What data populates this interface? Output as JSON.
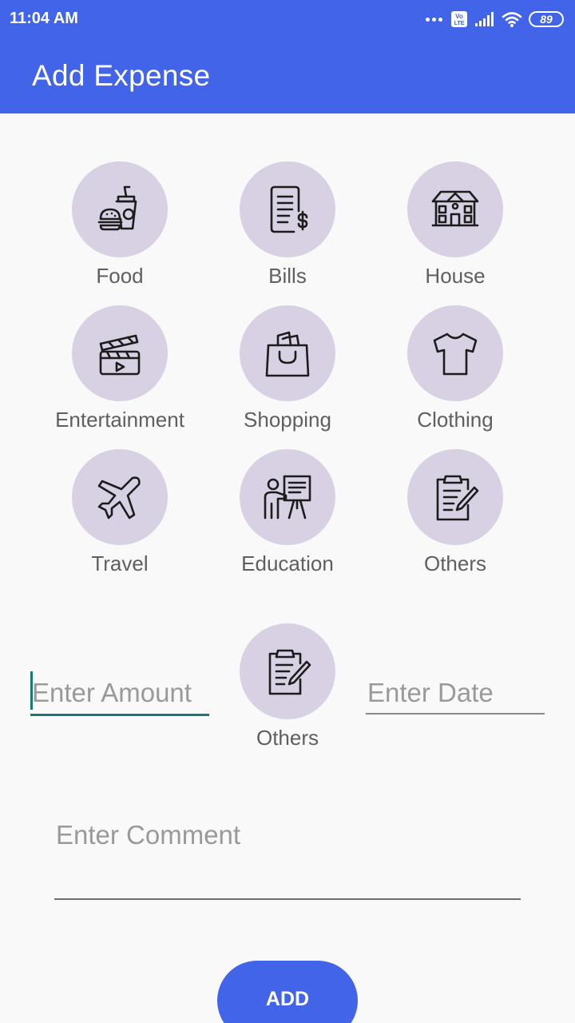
{
  "status_bar": {
    "time": "11:04 AM",
    "battery": "89",
    "network": "VoLTE"
  },
  "header": {
    "title": "Add Expense"
  },
  "categories": [
    {
      "label": "Food",
      "icon": "food-icon"
    },
    {
      "label": "Bills",
      "icon": "bills-icon"
    },
    {
      "label": "House",
      "icon": "house-icon"
    },
    {
      "label": "Entertainment",
      "icon": "clapperboard-icon"
    },
    {
      "label": "Shopping",
      "icon": "shopping-bag-icon"
    },
    {
      "label": "Clothing",
      "icon": "tshirt-icon"
    },
    {
      "label": "Travel",
      "icon": "airplane-icon"
    },
    {
      "label": "Education",
      "icon": "teacher-board-icon"
    },
    {
      "label": "Others",
      "icon": "clipboard-icon"
    }
  ],
  "selected_category": {
    "label": "Others",
    "icon": "clipboard-icon"
  },
  "form": {
    "amount_placeholder": "Enter Amount",
    "date_placeholder": "Enter Date",
    "comment_placeholder": "Enter Comment",
    "add_label": "ADD"
  },
  "colors": {
    "primary": "#4164e9",
    "icon_circle": "#d8d0e3",
    "focus_underline": "#167a6e"
  }
}
